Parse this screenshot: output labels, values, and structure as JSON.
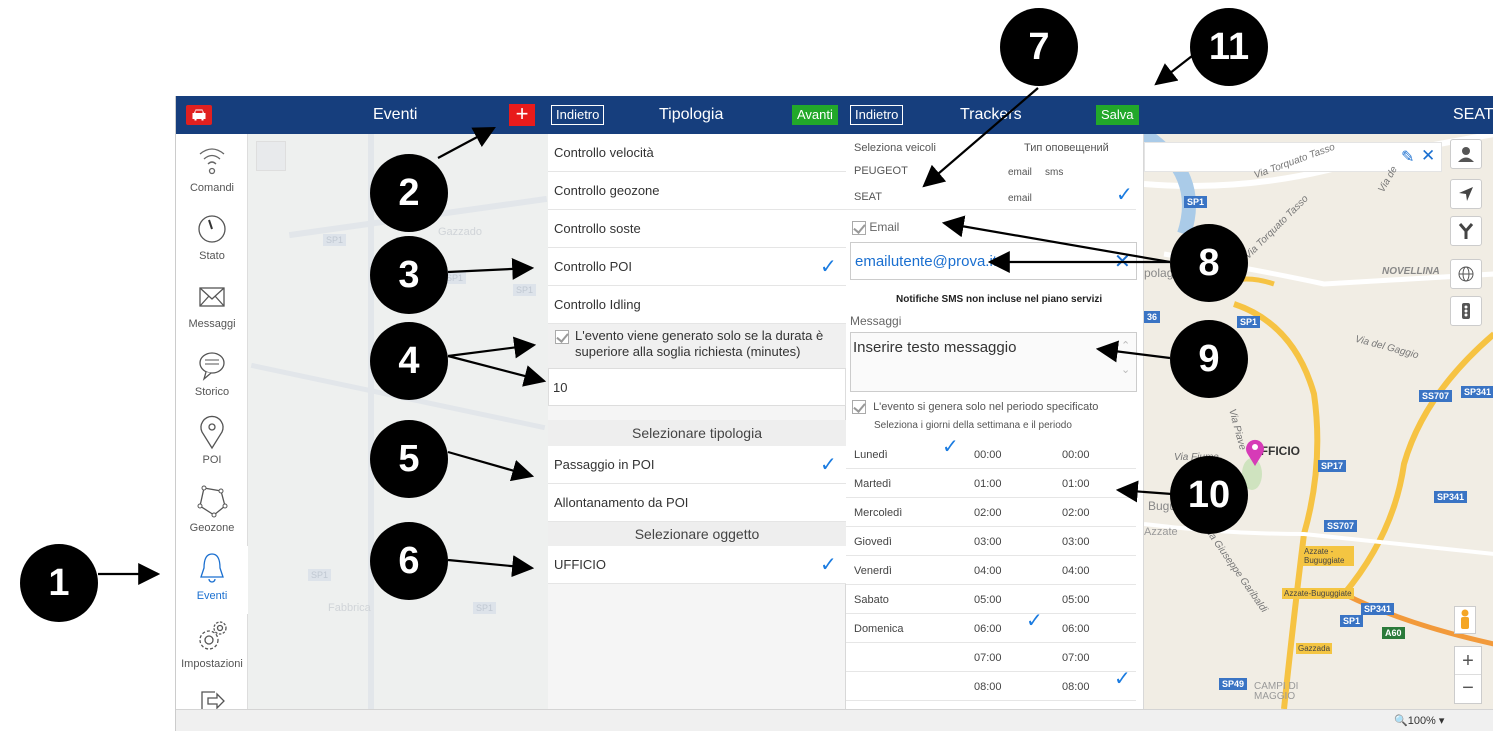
{
  "topbar": {
    "eventi": "Eventi",
    "indietro1": "Indietro",
    "tipologia": "Tipologia",
    "avanti": "Avanti",
    "indietro2": "Indietro",
    "trackers": "Trackers",
    "salva": "Salva",
    "vehicle": "SEAT",
    "plus": "+"
  },
  "sidebar": {
    "items": [
      {
        "label": "Comandi",
        "icon": "wifi-icon"
      },
      {
        "label": "Stato",
        "icon": "gauge-icon"
      },
      {
        "label": "Messaggi",
        "icon": "envelope-icon"
      },
      {
        "label": "Storico",
        "icon": "chat-bubble-icon"
      },
      {
        "label": "POI",
        "icon": "map-pin-icon"
      },
      {
        "label": "Geozone",
        "icon": "polygon-icon"
      },
      {
        "label": "Eventi",
        "icon": "bell-icon"
      },
      {
        "label": "Impostazioni",
        "icon": "gears-icon"
      },
      {
        "label": "",
        "icon": "logout-icon"
      }
    ],
    "active_index": 6
  },
  "tipologia": {
    "items": [
      {
        "label": "Controllo velocità",
        "checked": false
      },
      {
        "label": "Controllo geozone",
        "checked": false
      },
      {
        "label": "Controllo soste",
        "checked": false
      },
      {
        "label": "Controllo POI",
        "checked": true
      },
      {
        "label": "Controllo Idling",
        "checked": false
      }
    ],
    "duration_text_1": "L'evento viene generato solo se la durata è",
    "duration_text_2": "superiore alla soglia richiesta (minutes)",
    "duration_value": "10",
    "select_type_header": "Selezionare tipologia",
    "types": [
      {
        "label": "Passaggio in POI",
        "checked": true
      },
      {
        "label": "Allontanamento da POI",
        "checked": false
      }
    ],
    "select_object_header": "Selezionare oggetto",
    "objects": [
      {
        "label": "UFFICIO",
        "checked": true
      }
    ]
  },
  "trackers": {
    "select_vehicles": "Seleziona veicoli",
    "notification_type": "Тип оповещений",
    "vehicles": [
      {
        "name": "PEUGEOT",
        "email": "email",
        "sms": "sms",
        "checked": false
      },
      {
        "name": "SEAT",
        "email": "email",
        "sms": "",
        "checked": true
      }
    ],
    "email_checkbox": "Email",
    "email_value": "emailutente@prova.it",
    "sms_notice": "Notifiche SMS non incluse nel piano servizi",
    "messages_label": "Messaggi",
    "message_value": "Inserire testo messaggio",
    "period_checkbox": "L'evento si genera solo nel periodo specificato",
    "period_hint": "Seleziona i giorni della settimana e il periodo",
    "days": [
      {
        "day": "Lunedì",
        "from": "00:00",
        "to": "00:00",
        "day_checked": true,
        "from_checked": false,
        "to_checked": false
      },
      {
        "day": "Martedì",
        "from": "01:00",
        "to": "01:00",
        "day_checked": false,
        "from_checked": false,
        "to_checked": false
      },
      {
        "day": "Mercoledì",
        "from": "02:00",
        "to": "02:00",
        "day_checked": false,
        "from_checked": false,
        "to_checked": false
      },
      {
        "day": "Giovedì",
        "from": "03:00",
        "to": "03:00",
        "day_checked": false,
        "from_checked": false,
        "to_checked": false
      },
      {
        "day": "Venerdì",
        "from": "04:00",
        "to": "04:00",
        "day_checked": false,
        "from_checked": false,
        "to_checked": false
      },
      {
        "day": "Sabato",
        "from": "05:00",
        "to": "05:00",
        "day_checked": false,
        "from_checked": false,
        "to_checked": false
      },
      {
        "day": "Domenica",
        "from": "06:00",
        "to": "06:00",
        "day_checked": false,
        "from_checked": true,
        "to_checked": false
      },
      {
        "day": "",
        "from": "07:00",
        "to": "07:00",
        "day_checked": false,
        "from_checked": false,
        "to_checked": false
      },
      {
        "day": "",
        "from": "08:00",
        "to": "08:00",
        "day_checked": false,
        "from_checked": false,
        "to_checked": true
      }
    ]
  },
  "map": {
    "labels": [
      "Via Torquato Tasso",
      "Via Torquato Tasso",
      "NOVELLINA",
      "Via del Gaggio",
      "UFFICIO",
      "Via Piave",
      "Via Fiume",
      "Buguggiate",
      "Azzate",
      "Via Giuseppe Garibaldi",
      "Gazzada",
      "CAMPI DI MAGGIO",
      "Via de"
    ],
    "road_tags": [
      "SP1",
      "SP1",
      "SP1",
      "SS707",
      "SP341",
      "SP17",
      "SP341",
      "SS707",
      "SP341",
      "SP1",
      "SP49",
      "36",
      "A60"
    ],
    "yellow_tags": [
      "Azzate - Buguggiate",
      "Azzate-Buguggiate",
      "Gazzada"
    ],
    "partial_label": "polago"
  },
  "statusbar": {
    "zoom": "100%"
  },
  "callouts": [
    "1",
    "2",
    "3",
    "4",
    "5",
    "6",
    "7",
    "8",
    "9",
    "10",
    "11"
  ],
  "colors": {
    "topbar": "#163e7d",
    "red": "#e81b1b",
    "green": "#22a82a",
    "accent": "#1a7be0"
  }
}
